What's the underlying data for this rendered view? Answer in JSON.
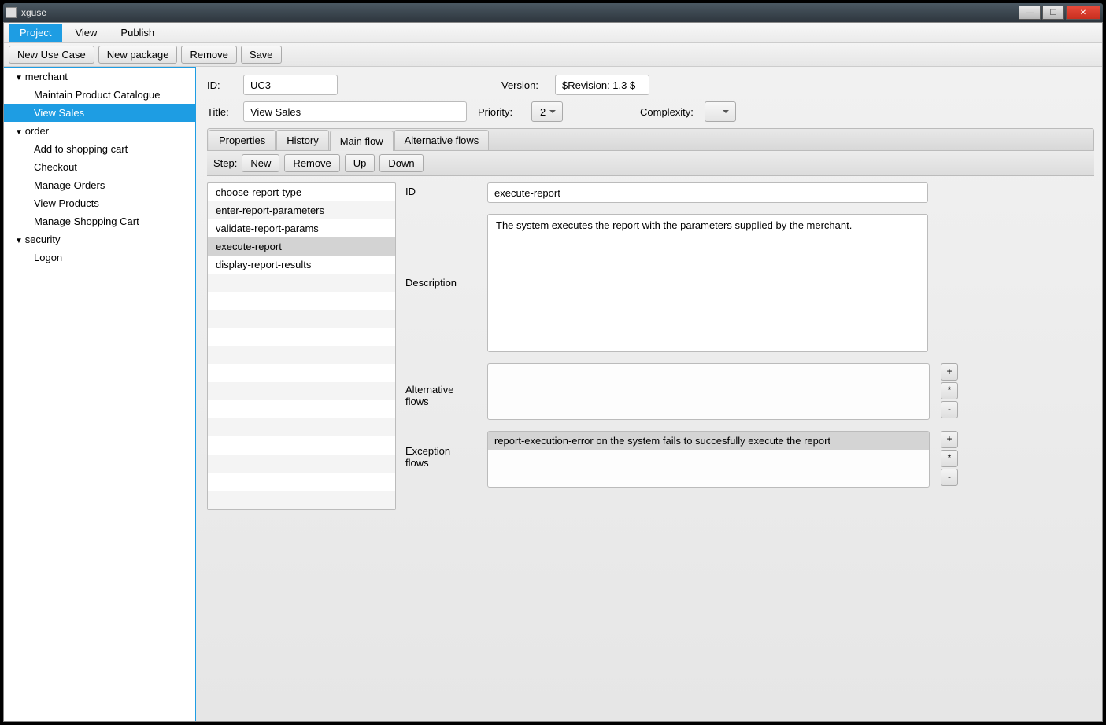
{
  "window": {
    "title": "xguse"
  },
  "menu": {
    "project": "Project",
    "view": "View",
    "publish": "Publish"
  },
  "toolbar": {
    "new_use_case": "New Use Case",
    "new_package": "New package",
    "remove": "Remove",
    "save": "Save"
  },
  "tree": {
    "merchant": {
      "label": "merchant",
      "items": [
        "Maintain Product Catalogue",
        "View Sales"
      ]
    },
    "order": {
      "label": "order",
      "items": [
        "Add to shopping cart",
        "Checkout",
        "Manage Orders",
        "View Products",
        "Manage Shopping Cart"
      ]
    },
    "security": {
      "label": "security",
      "items": [
        "Logon"
      ]
    }
  },
  "form": {
    "id_label": "ID:",
    "id_value": "UC3",
    "title_label": "Title:",
    "title_value": "View Sales",
    "version_label": "Version:",
    "version_value": "$Revision: 1.3 $",
    "priority_label": "Priority:",
    "priority_value": "2",
    "complexity_label": "Complexity:",
    "complexity_value": ""
  },
  "tabs": {
    "properties": "Properties",
    "history": "History",
    "main_flow": "Main flow",
    "alt_flows": "Alternative flows"
  },
  "stepbar": {
    "label": "Step:",
    "new": "New",
    "remove": "Remove",
    "up": "Up",
    "down": "Down"
  },
  "steps": [
    "choose-report-type",
    "enter-report-parameters",
    "validate-report-params",
    "execute-report",
    "display-report-results"
  ],
  "detail": {
    "id_label": "ID",
    "id_value": "execute-report",
    "desc_label": "Description",
    "desc_value": "The system executes the report with the parameters supplied by the merchant.",
    "alt_label": "Alternative flows",
    "exc_label": "Exception flows",
    "exc_entry": "report-execution-error on the system fails to succesfully execute the report"
  },
  "sym": {
    "plus": "+",
    "star": "*",
    "minus": "-"
  }
}
